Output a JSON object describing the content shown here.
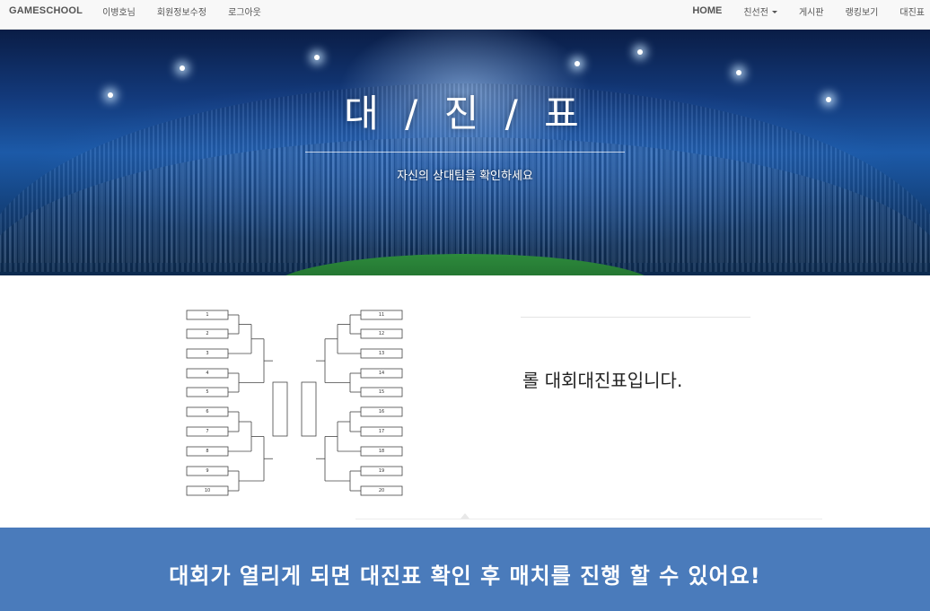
{
  "navbar": {
    "brand": "GAMESCHOOL",
    "left_items": [
      "이병호님",
      "회원정보수정",
      "로그아웃"
    ],
    "right_items": {
      "home": "HOME",
      "friendly": "친선전",
      "board": "게시판",
      "ranking": "랭킹보기",
      "bracket": "대진표"
    }
  },
  "hero": {
    "title": "대 / 진 / 표",
    "subtitle": "자신의 상대팀을 확인하세요"
  },
  "bracket": {
    "left_slots": [
      "1",
      "2",
      "3",
      "4",
      "5",
      "6",
      "7",
      "8",
      "9",
      "10"
    ],
    "right_slots": [
      "11",
      "12",
      "13",
      "14",
      "15",
      "16",
      "17",
      "18",
      "19",
      "20"
    ]
  },
  "info": {
    "text": "롤 대회대진표입니다."
  },
  "caption": {
    "text": "대회가 열리게 되면 대진표 확인 후 매치를 진행 할 수 있어요!"
  },
  "colors": {
    "navbar_bg": "#f8f8f8",
    "caption_bg": "#4a7bbb",
    "hero_blue": "#1c5aa8"
  }
}
